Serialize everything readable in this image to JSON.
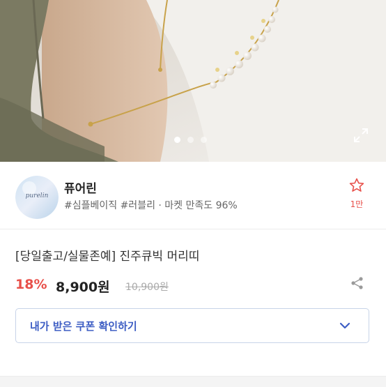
{
  "hero": {
    "slide_count": 3,
    "active_slide": 1,
    "expand_icon": "expand-icon"
  },
  "seller": {
    "avatar_text": "purelin",
    "name": "퓨어린",
    "tags": "#심플베이직 #러블리 · 마켓 만족도 96%",
    "favorite_icon": "star-outline-icon",
    "favorite_count": "1만"
  },
  "product": {
    "title": "[당일출고/실물존예] 진주큐빅 머리띠",
    "discount": "18%",
    "price": "8,900원",
    "original_price": "10,900원",
    "share_icon": "share-icon"
  },
  "coupon": {
    "label": "내가 받은 쿠폰 확인하기",
    "chevron_icon": "chevron-down-icon"
  },
  "colors": {
    "accent_red": "#e8504a",
    "coupon_blue": "#3e5ec4",
    "coupon_border": "#c7d3e8"
  }
}
